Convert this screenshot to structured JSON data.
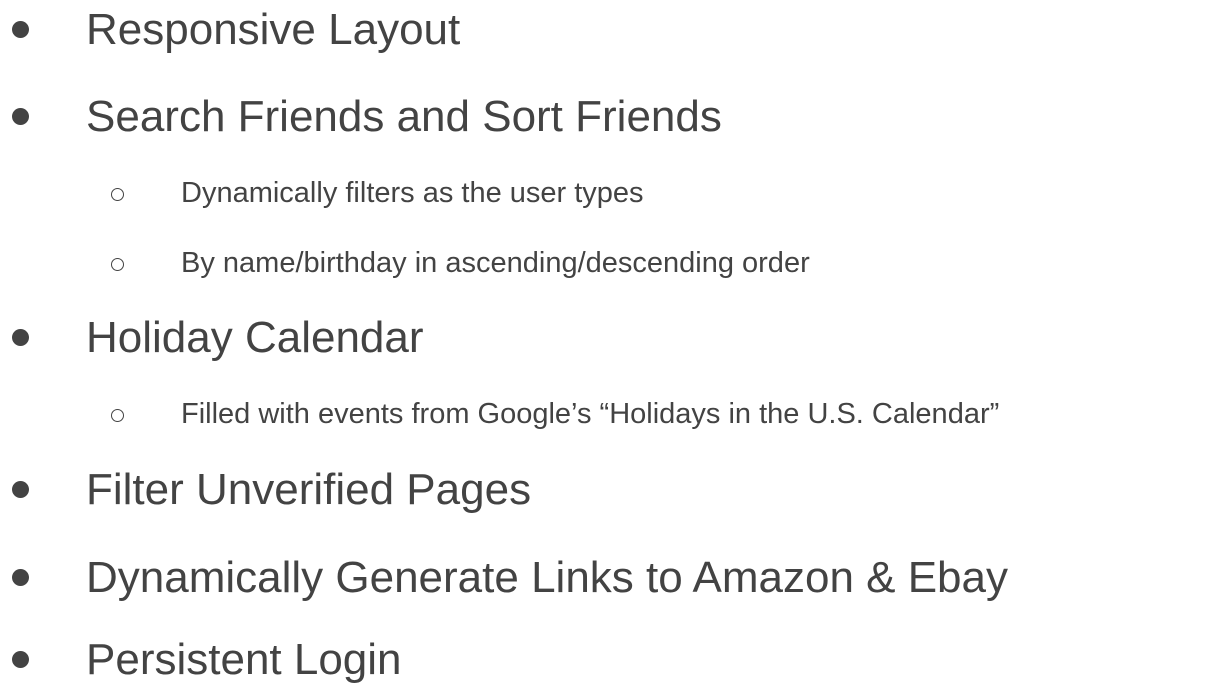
{
  "items": [
    {
      "text": "Responsive Layout",
      "level": 1,
      "bullet": "filled-circle"
    },
    {
      "text": "Search Friends and Sort Friends",
      "level": 1,
      "bullet": "filled-circle",
      "children": [
        {
          "text": "Dynamically filters as the user types",
          "level": 2,
          "bullet": "hollow-circle"
        },
        {
          "text": "By name/birthday in ascending/descending order",
          "level": 2,
          "bullet": "hollow-circle"
        }
      ]
    },
    {
      "text": "Holiday Calendar",
      "level": 1,
      "bullet": "filled-circle",
      "children": [
        {
          "text": "Filled with events from Google’s “Holidays in the U.S. Calendar”",
          "level": 2,
          "bullet": "hollow-circle"
        }
      ]
    },
    {
      "text": "Filter Unverified Pages",
      "level": 1,
      "bullet": "filled-circle"
    },
    {
      "text": "Dynamically Generate Links to Amazon & Ebay",
      "level": 1,
      "bullet": "filled-circle"
    },
    {
      "text": "Persistent Login",
      "level": 1,
      "bullet": "filled-circle"
    }
  ],
  "colors": {
    "text": "#434343",
    "background": "#ffffff"
  }
}
